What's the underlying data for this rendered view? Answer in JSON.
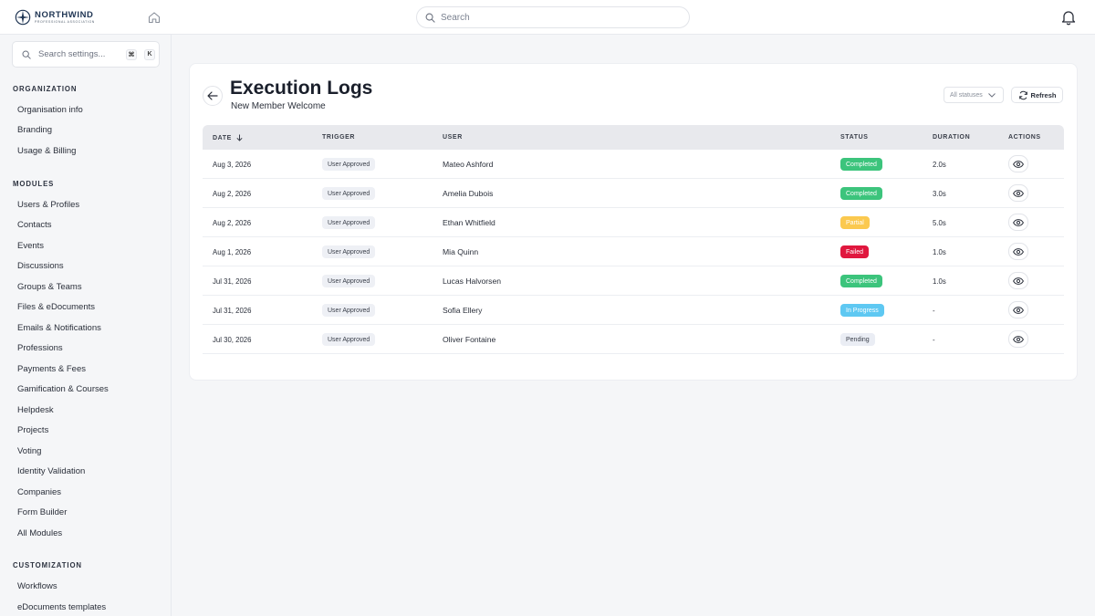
{
  "brand": {
    "name": "NORTHWIND",
    "tagline": "PROFESSIONAL ASSOCIATION"
  },
  "topbar": {
    "search_placeholder": "Search"
  },
  "sidebar": {
    "search_placeholder": "Search settings...",
    "shortcut_keys": [
      "⌘",
      "K"
    ],
    "sections": [
      {
        "title": "ORGANIZATION",
        "items": [
          "Organisation info",
          "Branding",
          "Usage & Billing"
        ]
      },
      {
        "title": "MODULES",
        "items": [
          "Users & Profiles",
          "Contacts",
          "Events",
          "Discussions",
          "Groups & Teams",
          "Files & eDocuments",
          "Emails & Notifications",
          "Professions",
          "Payments & Fees",
          "Gamification & Courses",
          "Helpdesk",
          "Projects",
          "Voting",
          "Identity Validation",
          "Companies",
          "Form Builder",
          "All Modules"
        ]
      },
      {
        "title": "CUSTOMIZATION",
        "items": [
          "Workflows",
          "eDocuments templates"
        ]
      }
    ]
  },
  "page": {
    "title": "Execution Logs",
    "subtitle": "New Member Welcome",
    "status_filter": "All statuses",
    "refresh_label": "Refresh"
  },
  "table": {
    "headers": {
      "date": "DATE",
      "trigger": "TRIGGER",
      "user": "USER",
      "status": "STATUS",
      "duration": "DURATION",
      "actions": "ACTIONS"
    },
    "rows": [
      {
        "date": "Aug 3, 2026",
        "trigger": "User Approved",
        "user": "Mateo Ashford",
        "status": "Completed",
        "duration": "2.0s"
      },
      {
        "date": "Aug 2, 2026",
        "trigger": "User Approved",
        "user": "Amelia Dubois",
        "status": "Completed",
        "duration": "3.0s"
      },
      {
        "date": "Aug 2, 2026",
        "trigger": "User Approved",
        "user": "Ethan Whitfield",
        "status": "Partial",
        "duration": "5.0s"
      },
      {
        "date": "Aug 1, 2026",
        "trigger": "User Approved",
        "user": "Mia Quinn",
        "status": "Failed",
        "duration": "1.0s"
      },
      {
        "date": "Jul 31, 2026",
        "trigger": "User Approved",
        "user": "Lucas Halvorsen",
        "status": "Completed",
        "duration": "1.0s"
      },
      {
        "date": "Jul 31, 2026",
        "trigger": "User Approved",
        "user": "Sofia Ellery",
        "status": "In Progress",
        "duration": "-"
      },
      {
        "date": "Jul 30, 2026",
        "trigger": "User Approved",
        "user": "Oliver Fontaine",
        "status": "Pending",
        "duration": "-"
      }
    ]
  },
  "status_colors": {
    "Completed": {
      "bg": "#3cc47c",
      "fg": "#ffffff"
    },
    "Partial": {
      "bg": "#fbc94f",
      "fg": "#ffffff"
    },
    "Failed": {
      "bg": "#e0173e",
      "fg": "#ffffff"
    },
    "In Progress": {
      "bg": "#5ec8f2",
      "fg": "#ffffff"
    },
    "Pending": {
      "bg": "#eaedf4",
      "fg": "#3a3f4a"
    }
  },
  "icons": {
    "logo": "compass-logo-icon",
    "home": "home-icon",
    "search": "search-icon",
    "bell": "bell-icon",
    "back": "arrow-left-icon",
    "chevron": "chevron-down-icon",
    "refresh": "refresh-icon",
    "sort": "arrow-down-icon",
    "view": "eye-icon"
  }
}
